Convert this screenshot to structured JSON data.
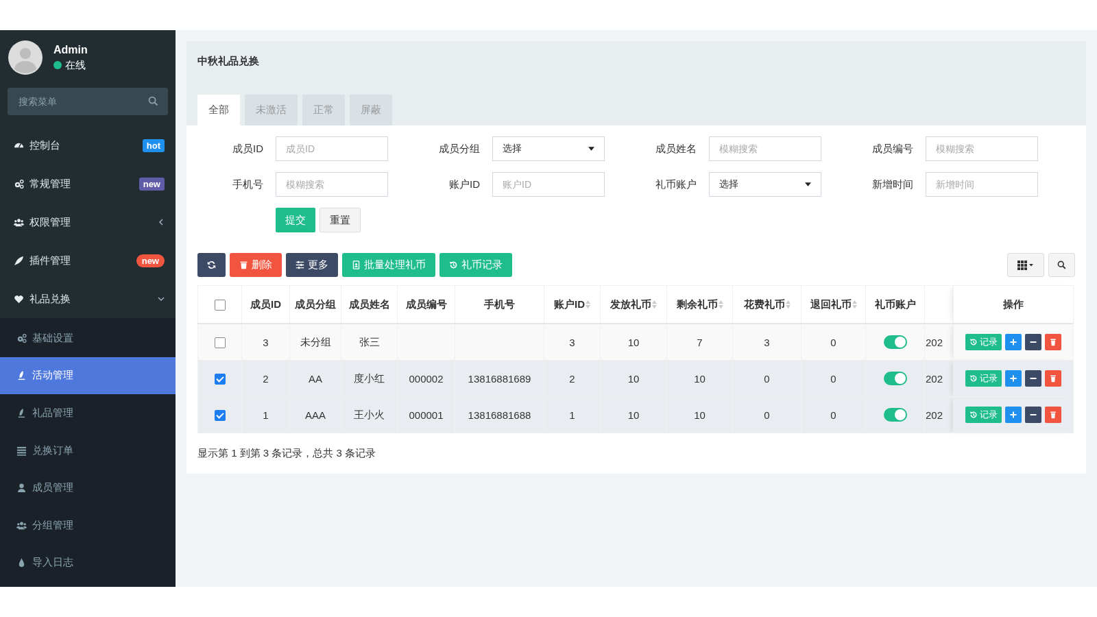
{
  "sidebar": {
    "user": {
      "name": "Admin",
      "status": "在线",
      "online": true
    },
    "search": {
      "placeholder": "搜索菜单"
    },
    "items": [
      {
        "label": "控制台",
        "badge": {
          "text": "hot",
          "color": "#1f8ff0",
          "kind": "label"
        }
      },
      {
        "label": "常规管理",
        "badge": {
          "text": "new",
          "color": "#605ca8",
          "kind": "label"
        }
      },
      {
        "label": "权限管理",
        "expanded": false
      },
      {
        "label": "插件管理",
        "badge": {
          "text": "new",
          "color": "#f2553f",
          "kind": "pill"
        }
      },
      {
        "label": "礼品兑换",
        "expanded": true,
        "children": [
          {
            "label": "基础设置",
            "selected": false
          },
          {
            "label": "活动管理",
            "selected": true
          },
          {
            "label": "礼品管理",
            "selected": false
          },
          {
            "label": "兑换订单",
            "selected": false
          },
          {
            "label": "成员管理",
            "selected": false
          },
          {
            "label": "分组管理",
            "selected": false
          },
          {
            "label": "导入日志",
            "selected": false
          }
        ]
      }
    ]
  },
  "panel": {
    "title": "中秋礼品兑换",
    "tabs": [
      {
        "label": "全部",
        "selected": true
      },
      {
        "label": "未激活",
        "selected": false
      },
      {
        "label": "正常",
        "selected": false
      },
      {
        "label": "屏蔽",
        "selected": false
      }
    ],
    "filters": [
      {
        "label": "成员ID",
        "kind": "input",
        "placeholder": "成员ID"
      },
      {
        "label": "成员分组",
        "kind": "select",
        "value": "选择"
      },
      {
        "label": "成员姓名",
        "kind": "input",
        "placeholder": "模糊搜索"
      },
      {
        "label": "成员编号",
        "kind": "input",
        "placeholder": "模糊搜索"
      },
      {
        "label": "手机号",
        "kind": "input",
        "placeholder": "模糊搜索"
      },
      {
        "label": "账户ID",
        "kind": "input",
        "placeholder": "账户ID"
      },
      {
        "label": "礼币账户",
        "kind": "select",
        "value": "选择"
      },
      {
        "label": "新增时间",
        "kind": "input",
        "placeholder": "新增时间"
      }
    ],
    "form_buttons": [
      {
        "label": "提交",
        "kind": "primary"
      },
      {
        "label": "重置",
        "kind": "default"
      }
    ],
    "toolbar": [
      {
        "kind": "refresh"
      },
      {
        "kind": "delete",
        "label": "删除"
      },
      {
        "kind": "more",
        "label": "更多"
      },
      {
        "kind": "batch",
        "label": "批量处理礼币"
      },
      {
        "kind": "record",
        "label": "礼币记录"
      }
    ],
    "table": {
      "columns": [
        {
          "label": "成员ID",
          "sortable": false
        },
        {
          "label": "成员分组",
          "sortable": false
        },
        {
          "label": "成员姓名",
          "sortable": false
        },
        {
          "label": "成员编号",
          "sortable": false
        },
        {
          "label": "手机号",
          "sortable": false
        },
        {
          "label": "账户ID",
          "sortable": true
        },
        {
          "label": "发放礼币",
          "sortable": true
        },
        {
          "label": "剩余礼币",
          "sortable": true
        },
        {
          "label": "花费礼币",
          "sortable": true
        },
        {
          "label": "退回礼币",
          "sortable": true
        },
        {
          "label": "礼币账户",
          "sortable": false
        },
        {
          "label": "操作",
          "sortable": false
        }
      ],
      "all_checked": false,
      "rows": [
        {
          "checked": false,
          "cells": [
            "3",
            "未分组",
            "张三",
            "",
            "",
            "3",
            "10",
            "7",
            "3",
            "0"
          ],
          "account_on": true,
          "column_12": "202",
          "actions": [
            {
              "kind": "record",
              "label": "记录"
            },
            {
              "kind": "add"
            },
            {
              "kind": "minus"
            },
            {
              "kind": "delete"
            }
          ]
        },
        {
          "checked": true,
          "cells": [
            "2",
            "AA",
            "度小红",
            "000002",
            "13816881689",
            "2",
            "10",
            "10",
            "0",
            "0"
          ],
          "account_on": true,
          "column_12": "202",
          "actions": [
            {
              "kind": "record",
              "label": "记录"
            },
            {
              "kind": "add"
            },
            {
              "kind": "minus"
            },
            {
              "kind": "delete"
            }
          ]
        },
        {
          "checked": true,
          "cells": [
            "1",
            "AAA",
            "王小火",
            "000001",
            "13816881688",
            "1",
            "10",
            "10",
            "0",
            "0"
          ],
          "account_on": true,
          "column_12": "202",
          "actions": [
            {
              "kind": "record",
              "label": "记录"
            },
            {
              "kind": "add"
            },
            {
              "kind": "minus"
            },
            {
              "kind": "delete"
            }
          ]
        }
      ]
    },
    "footer": "显示第 1 到第 3 条记录，总共 3 条记录"
  }
}
